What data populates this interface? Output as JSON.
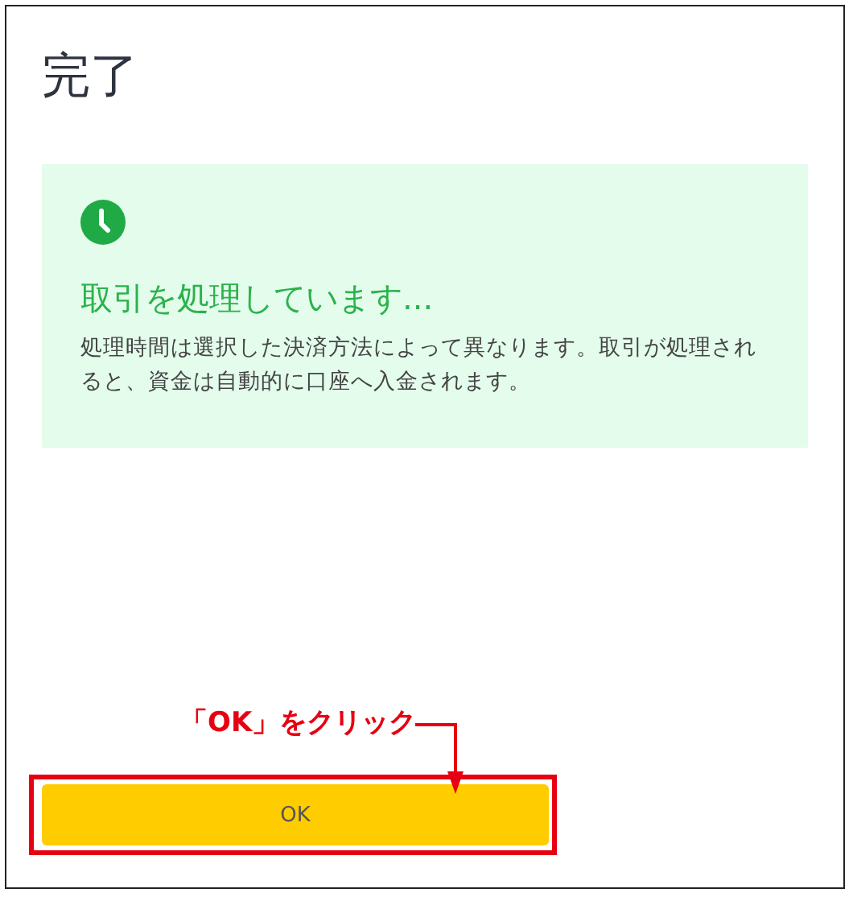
{
  "title": "完了",
  "status": {
    "heading": "取引を処理しています...",
    "message": "処理時間は選択した決済方法によって異なります。取引が処理されると、資金は自動的に口座へ入金されます。"
  },
  "annotation": {
    "text": "「OK」をクリック"
  },
  "button": {
    "label": "OK"
  }
}
